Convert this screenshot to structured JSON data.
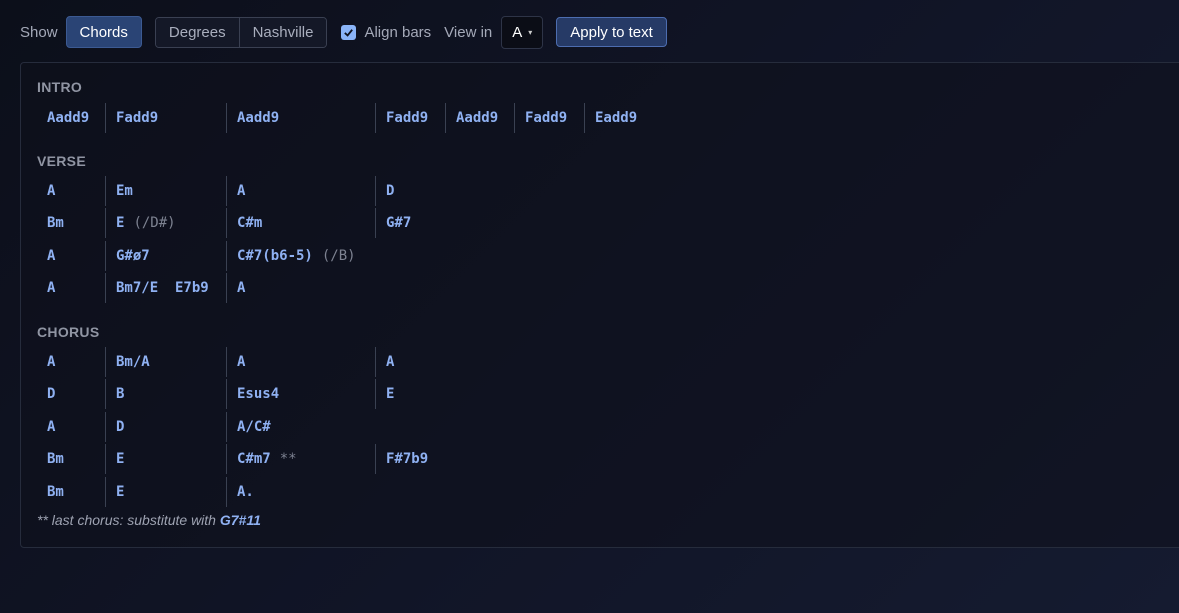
{
  "toolbar": {
    "show_label": "Show",
    "chords_label": "Chords",
    "degrees_label": "Degrees",
    "nashville_label": "Nashville",
    "align_bars_label": "Align bars",
    "view_in_label": "View in",
    "key_value": "A",
    "apply_label": "Apply to text"
  },
  "sections": {
    "intro": {
      "title": "INTRO",
      "rows": [
        [
          "Aadd9",
          "Fadd9",
          "Aadd9",
          "Fadd9",
          "Aadd9",
          "Fadd9",
          "Eadd9"
        ]
      ]
    },
    "verse": {
      "title": "VERSE",
      "rows": [
        [
          "A",
          "Em",
          "A",
          "D"
        ],
        [
          "Bm",
          "E",
          "(/D#)",
          "C#m",
          "G#7"
        ],
        [
          "A",
          "G#ø7",
          "C#7(b6-5)",
          "(/B)"
        ],
        [
          "A",
          "Bm7/E  E7b9",
          "A"
        ]
      ]
    },
    "chorus": {
      "title": "CHORUS",
      "rows": [
        [
          "A",
          "Bm/A",
          "A",
          "A"
        ],
        [
          "D",
          "B",
          "Esus4",
          "E"
        ],
        [
          "A",
          "D",
          "A/C#"
        ],
        [
          "Bm",
          "E",
          "C#m7",
          "**",
          "F#7b9"
        ],
        [
          "Bm",
          "E",
          "A."
        ]
      ]
    }
  },
  "footnote": {
    "text": "** last chorus: substitute with",
    "chord": "G7#11"
  }
}
